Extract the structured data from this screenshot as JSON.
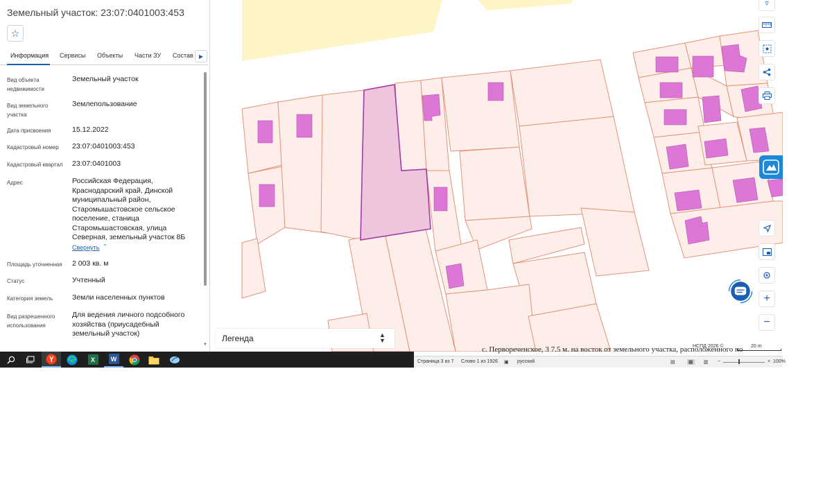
{
  "panel": {
    "title": "Земельный участок: 23:07:0401003:453",
    "favorite_icon": "star-outline-icon",
    "tabs": [
      "Информация",
      "Сервисы",
      "Объекты",
      "Части ЗУ",
      "Состав"
    ],
    "active_tab": "Информация",
    "tabs_next_icon": "chevron-right-icon",
    "fields": [
      {
        "label": "Вид объекта недвижимости",
        "value": "Земельный участок"
      },
      {
        "label": "Вид земельного участка",
        "value": "Землепользование"
      },
      {
        "label": "Дата присвоения",
        "value": "15.12.2022"
      },
      {
        "label": "Кадастровый номер",
        "value": "23:07:0401003:453"
      },
      {
        "label": "Кадастровый квартал",
        "value": "23:07:0401003"
      },
      {
        "label": "Адрес",
        "value": "Российская Федерация, Краснодарский край, Динской муниципальный район, Старомышастовское сельское поселение, станица Старомышастовская, улица Северная, земельный участок 8Б"
      },
      {
        "label": "Площадь уточненная",
        "value": "2 003 кв. м"
      },
      {
        "label": "Статус",
        "value": "Учтенный"
      },
      {
        "label": "Категория земель",
        "value": "Земли населенных пунктов"
      },
      {
        "label": "Вид разрешенного использования",
        "value": "Для ведения личного подсобного хозяйства (приусадебный земельный участок)"
      }
    ],
    "collapse_label": "Свернуть",
    "collapse_icon": "chevron-up-icon"
  },
  "map": {
    "legend_label": "Легенда",
    "legend_icon": "sort-arrows-icon",
    "attribution": "НСПД 2026 ©",
    "scale_label": "20 m",
    "tools_top": [
      "layers-icon",
      "ruler-icon",
      "select-area-icon",
      "share-icon",
      "print-icon"
    ],
    "tools_bottom": [
      "navigation-arrow-icon",
      "basemap-icon",
      "locate-icon",
      "zoom-in-icon",
      "zoom-out-icon"
    ],
    "colors": {
      "parcel_fill": "#fdeeea",
      "parcel_border": "#e3937a",
      "building_fill": "#dd77d6",
      "selected_fill": "#efc5de",
      "selected_border": "#a23aa8",
      "zone_fill": "#fdf5c6",
      "accent": "#1b5fb5"
    }
  },
  "document": {
    "text_line": "с. Первореченское, 3 7.5 м. на восток от земельного участка, расположенного по"
  },
  "word_status": {
    "page": "Страница 3 из 7",
    "words": "Слово 1 из 1926",
    "language": "русский",
    "zoom": "100%"
  },
  "taskbar": {
    "items": [
      "search-icon",
      "task-view-icon",
      "yandex-browser-icon",
      "edge-icon",
      "excel-icon",
      "word-icon",
      "chrome-icon",
      "file-explorer-icon",
      "app-icon"
    ],
    "excel_letter": "X",
    "word_letter": "W"
  }
}
